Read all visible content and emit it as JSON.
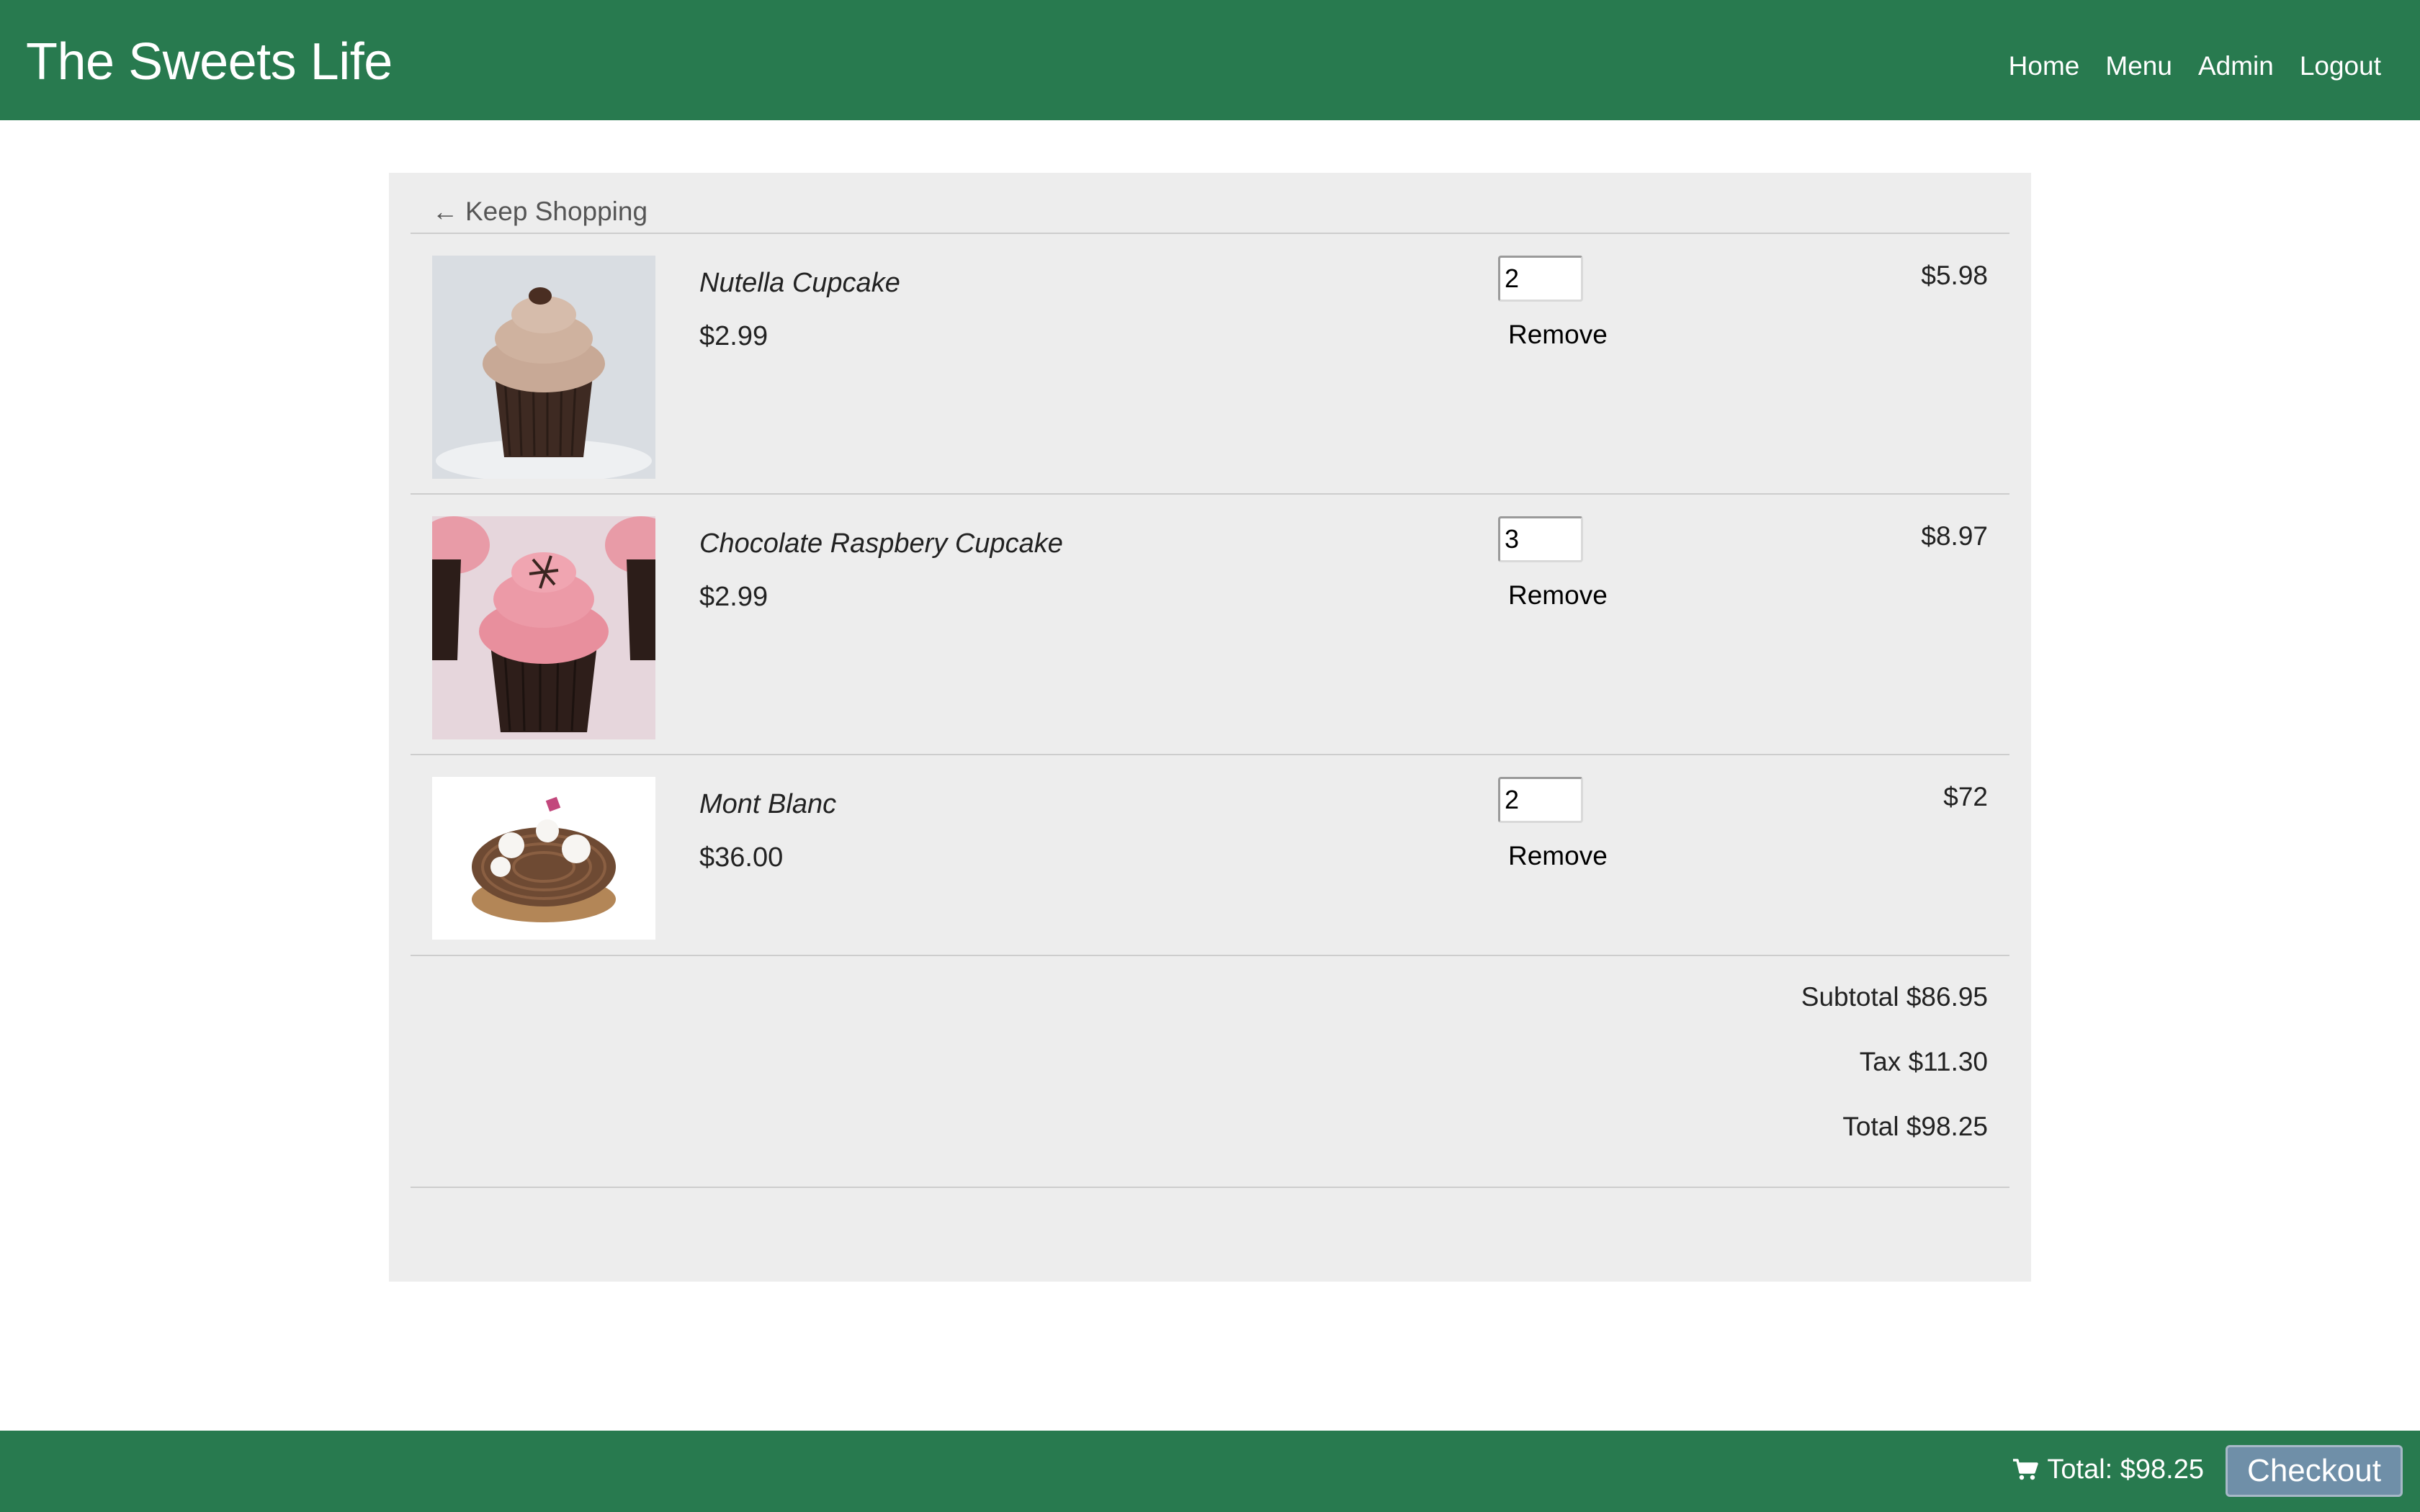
{
  "header": {
    "brand": "The Sweets Life",
    "nav": [
      {
        "label": "Home"
      },
      {
        "label": "Menu"
      },
      {
        "label": "Admin"
      },
      {
        "label": "Logout"
      }
    ]
  },
  "cart": {
    "back_arrow": "←",
    "back_label": "Keep Shopping",
    "items": [
      {
        "name": "Nutella Cupcake",
        "price": "$2.99",
        "quantity": "2",
        "remove_label": "Remove",
        "line_total": "$5.98",
        "image_icon": "nutella-cupcake-photo"
      },
      {
        "name": "Chocolate Raspbery Cupcake",
        "price": "$2.99",
        "quantity": "3",
        "remove_label": "Remove",
        "line_total": "$8.97",
        "image_icon": "chocolate-raspberry-cupcake-photo"
      },
      {
        "name": "Mont Blanc",
        "price": "$36.00",
        "quantity": "2",
        "remove_label": "Remove",
        "line_total": "$72",
        "image_icon": "mont-blanc-cake-photo"
      }
    ],
    "subtotal": "Subtotal $86.95",
    "tax": "Tax $11.30",
    "total": "Total $98.25"
  },
  "footer": {
    "cart_icon": "shopping-cart-icon",
    "total_label": "Total: $98.25",
    "checkout_label": "Checkout"
  },
  "colors": {
    "brand_green": "#287a4f",
    "panel_gray": "#ededed",
    "checkout_button": "#6f8fa8"
  }
}
